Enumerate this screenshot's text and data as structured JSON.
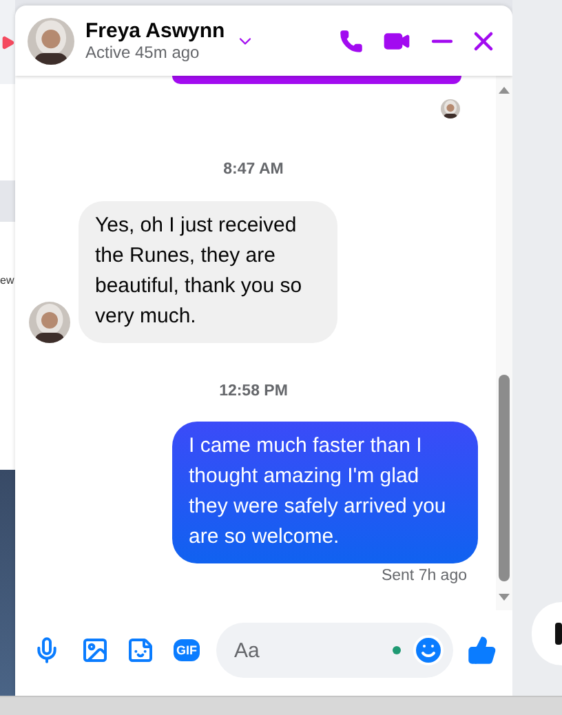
{
  "background": {
    "fragment_text": "ew"
  },
  "header": {
    "name": "Freya Aswynn",
    "status": "Active 45m ago"
  },
  "messages": [
    {
      "kind": "outgoing_cropped"
    },
    {
      "kind": "seen_avatar"
    },
    {
      "kind": "timestamp",
      "text": "8:47 AM"
    },
    {
      "kind": "incoming",
      "text": "Yes, oh I just received the Runes, they are beautiful, thank you so very much."
    },
    {
      "kind": "timestamp",
      "text": "12:58 PM"
    },
    {
      "kind": "outgoing",
      "text": "I came much faster than I thought amazing I'm glad they were safely arrived you are so welcome."
    },
    {
      "kind": "receipt",
      "text": "Sent 7h ago"
    }
  ],
  "composer": {
    "gif_label": "GIF",
    "placeholder": "Aa",
    "online": true
  }
}
